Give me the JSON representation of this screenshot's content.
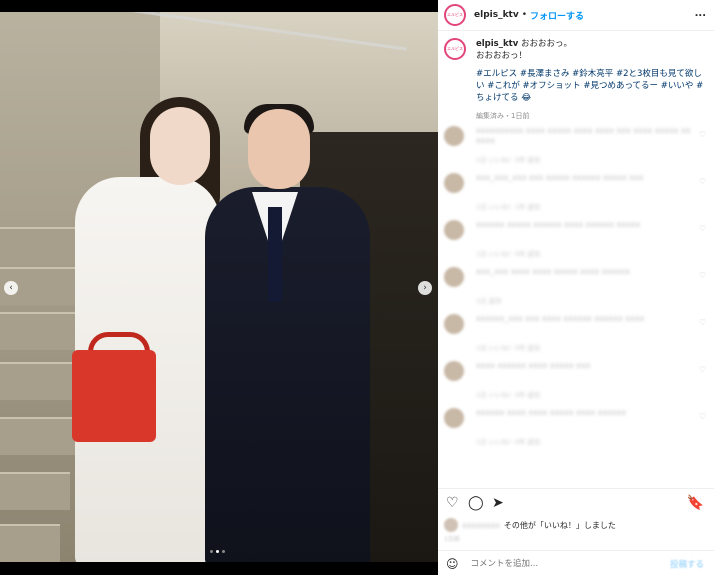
{
  "post": {
    "username": "elpis_ktv",
    "separator": "•",
    "follow_label": "フォローする",
    "more_label": "...",
    "avatar_text": "エルピス",
    "caption_line1": "おおおおっ。",
    "caption_line2": "おおおおっ！",
    "hashtags": "#エルピス #長澤まさみ #鈴木亮平 #2と3枚目も見て欲しい #これが #オフショット #見つめあってるー #いいや #ちょけてる 😂",
    "edited_label": "編集済み・1日前"
  },
  "carousel": {
    "prev_label": "‹",
    "next_label": "›",
    "dot_count": 3,
    "active_index": 1
  },
  "comments": [
    {
      "text": "xxxxxxxxxx xxxx xxxxx xxxx xxxx xxx xxxx xxxxx xx xxxx",
      "meta": "1日 いいね！0件 返信"
    },
    {
      "text": "xxx_xxx_xxx xxx xxxxx xxxxxx xxxxx xxx",
      "meta": "1日 いいね！1件 返信"
    },
    {
      "text": "xxxxxx xxxxx xxxxxx xxxx xxxxxx xxxxx",
      "meta": "1日 いいね！0件 返信"
    },
    {
      "text": "xxx_xxx xxxx xxxx xxxxx xxxx xxxxxx",
      "meta": "1日 返信"
    },
    {
      "text": "xxxxxx_xxx xxx xxxx xxxxxx xxxxxx xxxx",
      "meta": "1日 いいね！0件 返信"
    },
    {
      "text": "xxxx xxxxxx xxxx xxxxx xxx",
      "meta": "1日 いいね！0件 返信"
    },
    {
      "text": "xxxxxx xxxx xxxx xxxxx xxxx xxxxxx",
      "meta": "1日 いいね！0件 返信"
    }
  ],
  "actions": {
    "like_icon": "♡",
    "comment_icon": "◯",
    "share_icon": "➤",
    "save_icon": "🔖"
  },
  "likes": {
    "blurred_name": "xxxxxxxx",
    "suffix": "その他が「いいね！」しました"
  },
  "date_label": "1日前",
  "composer": {
    "emoji_icon": "☺",
    "placeholder": "コメントを追加...",
    "post_label": "投稿する"
  }
}
